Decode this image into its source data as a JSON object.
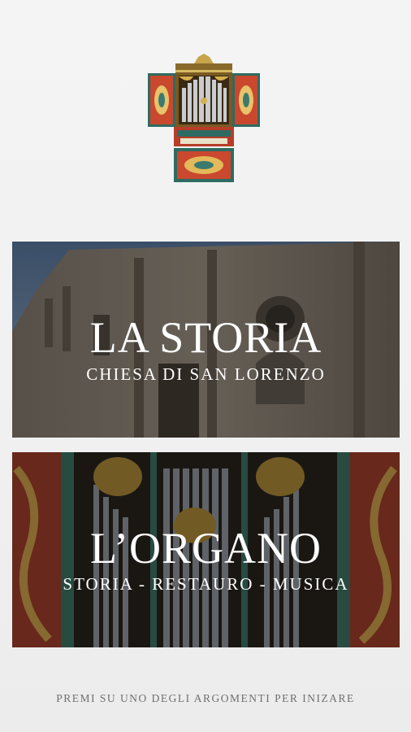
{
  "logo": {
    "icon": "organ-logo-icon"
  },
  "cards": [
    {
      "title": "LA STORIA",
      "subtitle": "CHIESA DI SAN LORENZO",
      "image": "church-facade-image"
    },
    {
      "title": "L’ORGANO",
      "subtitle": "STORIA - RESTAURO - MUSICA",
      "image": "organ-pipes-image"
    }
  ],
  "footer": {
    "hint": "PREMI SU UNO DEGLI ARGOMENTI PER INIZARE"
  },
  "colors": {
    "background": "#f1f1f1",
    "text_light": "#ffffff",
    "hint_text": "#6f6f6f"
  }
}
